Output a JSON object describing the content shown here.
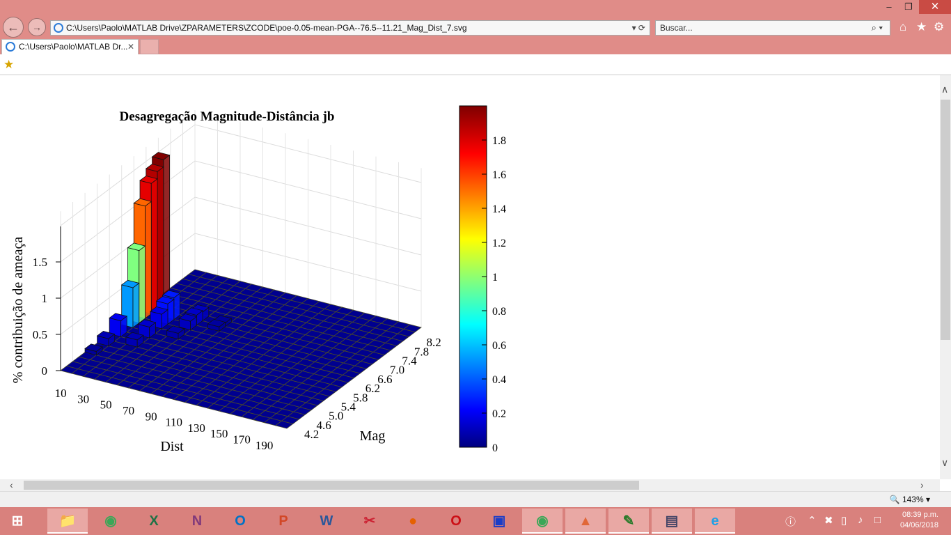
{
  "window": {
    "address": "C:\\Users\\Paolo\\MATLAB Drive\\ZPARAMETERS\\ZCODE\\poe-0.05-mean-PGA--76.5--11.21_Mag_Dist_7.svg",
    "search_placeholder": "Buscar...",
    "tab_label": "C:\\Users\\Paolo\\MATLAB Dr...",
    "zoom": "143%"
  },
  "chart_data": {
    "type": "bar3d",
    "title": "Desagregação Magnitude-Distância jb",
    "xlabel": "Dist",
    "ylabel": "Mag",
    "zlabel": "% contribuição de ameaça",
    "dist_ticks": [
      "10",
      "30",
      "50",
      "70",
      "90",
      "110",
      "130",
      "150",
      "170",
      "190"
    ],
    "mag_ticks": [
      "4.2",
      "4.6",
      "5.0",
      "5.4",
      "5.8",
      "6.2",
      "6.6",
      "7.0",
      "7.4",
      "7.8",
      "8.2"
    ],
    "z_ticks": [
      "0",
      "0.5",
      "1",
      "1.5"
    ],
    "zlim": [
      0,
      2.0
    ],
    "colorbar_ticks": [
      "0",
      "0.2",
      "0.4",
      "0.6",
      "0.8",
      "1",
      "1.2",
      "1.4",
      "1.6",
      "1.8"
    ],
    "colorbar_range": [
      0,
      2.0
    ],
    "bars": [
      {
        "dist": 10,
        "mag": 6.2,
        "value": 0.55
      },
      {
        "dist": 10,
        "mag": 6.4,
        "value": 1.0
      },
      {
        "dist": 10,
        "mag": 6.6,
        "value": 1.55
      },
      {
        "dist": 10,
        "mag": 6.8,
        "value": 1.8
      },
      {
        "dist": 10,
        "mag": 7.0,
        "value": 1.9
      },
      {
        "dist": 10,
        "mag": 7.2,
        "value": 2.0
      },
      {
        "dist": 10,
        "mag": 5.8,
        "value": 0.22
      },
      {
        "dist": 10,
        "mag": 5.4,
        "value": 0.1
      },
      {
        "dist": 10,
        "mag": 5.0,
        "value": 0.05
      },
      {
        "dist": 30,
        "mag": 6.4,
        "value": 0.2
      },
      {
        "dist": 30,
        "mag": 6.6,
        "value": 0.28
      },
      {
        "dist": 30,
        "mag": 6.8,
        "value": 0.3
      },
      {
        "dist": 30,
        "mag": 6.0,
        "value": 0.15
      },
      {
        "dist": 30,
        "mag": 5.6,
        "value": 0.1
      },
      {
        "dist": 50,
        "mag": 6.6,
        "value": 0.12
      },
      {
        "dist": 50,
        "mag": 6.8,
        "value": 0.14
      },
      {
        "dist": 50,
        "mag": 7.0,
        "value": 0.12
      },
      {
        "dist": 50,
        "mag": 6.2,
        "value": 0.08
      },
      {
        "dist": 70,
        "mag": 6.8,
        "value": 0.06
      },
      {
        "dist": 70,
        "mag": 7.0,
        "value": 0.05
      }
    ]
  }
}
